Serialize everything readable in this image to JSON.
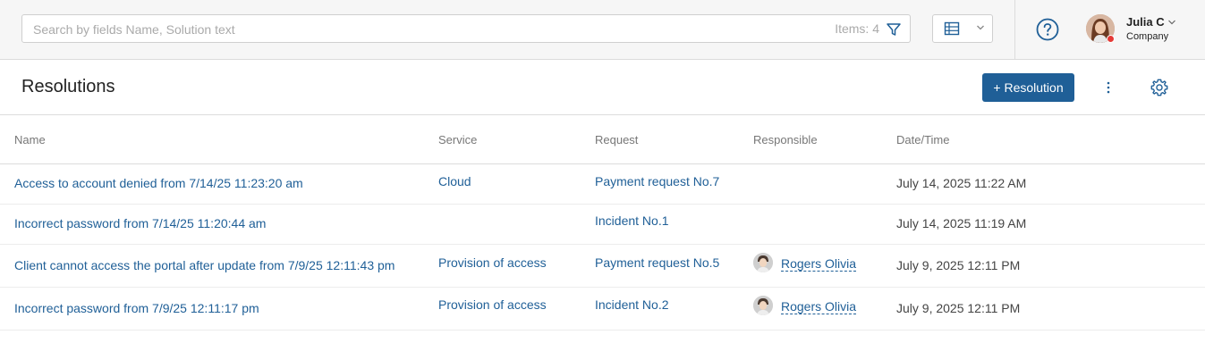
{
  "search": {
    "placeholder": "Search by fields Name, Solution text",
    "items_label": "Items: 4"
  },
  "user": {
    "name": "Julia C",
    "company": "Company",
    "status_color": "#e53935"
  },
  "page": {
    "title": "Resolutions",
    "add_button": "+ Resolution"
  },
  "colors": {
    "accent": "#1f5f97",
    "link": "#1f5f97"
  },
  "table": {
    "columns": [
      "Name",
      "Service",
      "Request",
      "Responsible",
      "Date/Time"
    ],
    "rows": [
      {
        "name": "Access to account denied from 7/14/25 11:23:20 am",
        "service": "Cloud",
        "request": "Payment request No.7",
        "responsible": "",
        "datetime": "July 14, 2025 11:22 AM"
      },
      {
        "name": "Incorrect password from 7/14/25 11:20:44 am",
        "service": "",
        "request": "Incident No.1",
        "responsible": "",
        "datetime": "July 14, 2025 11:19 AM"
      },
      {
        "name": "Client cannot access the portal after update from 7/9/25 12:11:43 pm",
        "service": "Provision of access",
        "request": "Payment request No.5",
        "responsible": "Rogers Olivia",
        "datetime": "July 9, 2025 12:11 PM"
      },
      {
        "name": "Incorrect password from 7/9/25 12:11:17 pm",
        "service": "Provision of access",
        "request": "Incident No.2",
        "responsible": "Rogers Olivia",
        "datetime": "July 9, 2025 12:11 PM"
      }
    ]
  }
}
